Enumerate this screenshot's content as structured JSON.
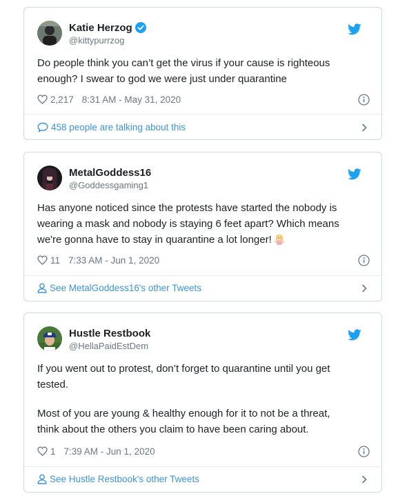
{
  "tweets": [
    {
      "name": "Katie Herzog",
      "handle": "@kittypurrzog",
      "verified": true,
      "text_lines": [
        "Do people think you can’t get the virus if your cause is righteous",
        "enough? I swear to god we were just under quarantine"
      ],
      "likes": "2,217",
      "timestamp": "8:31 AM - May 31, 2020",
      "footer": "458 people are talking about this",
      "footer_icon": "comment-icon"
    },
    {
      "name": "MetalGoddess16",
      "handle": "@Goddessgaming1",
      "verified": false,
      "text_lines": [
        "Has anyone noticed since the protests have started the nobody is",
        "wearing a mask and nobody is staying 6 feet apart? Which means",
        "we're gonna have to stay in quarantine a lot longer!"
      ],
      "emoji": "woman-shrugging-emoji",
      "likes": "11",
      "timestamp": "7:33 AM - Jun 1, 2020",
      "footer": "See MetalGoddess16's other Tweets",
      "footer_icon": "person-icon"
    },
    {
      "name": "Hustle Restbook",
      "handle": "@HellaPaidEstDem",
      "verified": false,
      "text_lines": [
        "If you went out to protest, don’t forget to quarantine until you get",
        "tested.",
        "",
        "Most of you are young & healthy enough for it to not be a threat,",
        "think about the others you claim to have been caring about."
      ],
      "likes": "1",
      "timestamp": "7:39 AM - Jun 1, 2020",
      "footer": "See Hustle Restbook's other Tweets",
      "footer_icon": "person-icon"
    }
  ],
  "colors": {
    "link": "#3b94d9",
    "verified": "#1da1f2",
    "bird": "#1da1f2",
    "meta_text": "#697882",
    "border": "#cfd9de"
  }
}
